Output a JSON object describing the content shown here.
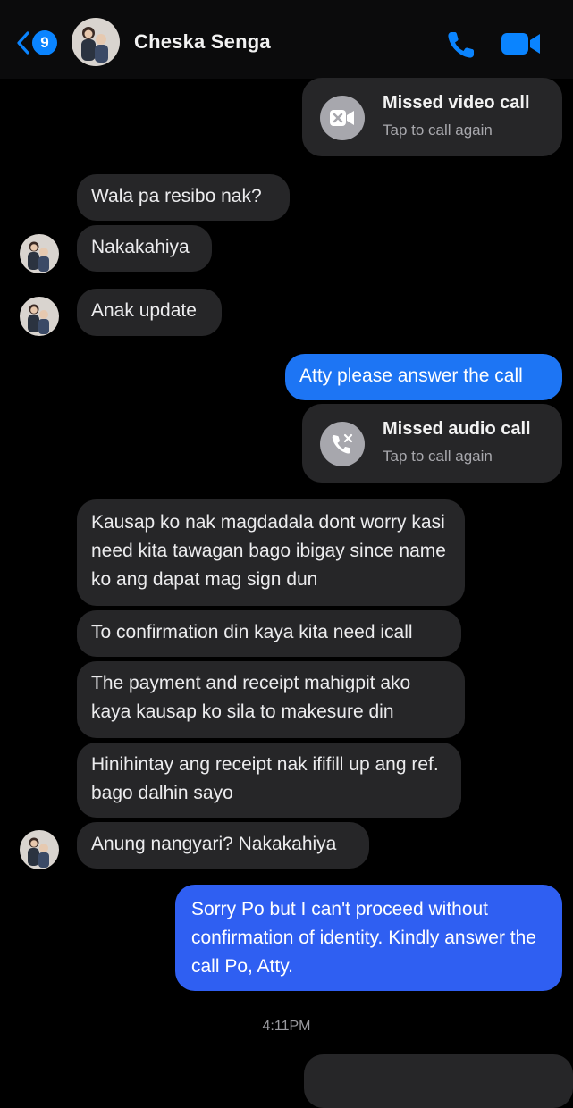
{
  "header": {
    "unread_count": "9",
    "contact_name": "Cheska Senga",
    "back_icon": "chevron-left-icon",
    "call_icon": "phone-icon",
    "video_icon": "video-camera-icon",
    "accent_color": "#0a84ff"
  },
  "messages": {
    "missed_video": {
      "title": "Missed video call",
      "subtitle": "Tap to call again",
      "icon": "video-missed-icon"
    },
    "m1": "Wala pa resibo nak?",
    "m2": "Nakakahiya",
    "m3": "Anak update",
    "m4": "Atty please answer the call",
    "missed_audio": {
      "title": "Missed audio call",
      "subtitle": "Tap to call again",
      "icon": "phone-missed-icon"
    },
    "m5": "Kausap ko nak magdadala dont worry kasi need kita tawagan bago ibigay since name ko ang dapat mag sign dun",
    "m6": "To confirmation din kaya kita need icall",
    "m7": "The payment and receipt mahigpit ako kaya kausap ko sila to makesure din",
    "m8": "Hinihintay ang receipt nak ififill up ang ref. bago dalhin sayo",
    "m9": "Anung nangyari? Nakakahiya",
    "m10": "Sorry Po but I can't proceed without confirmation of identity. Kindly answer the call Po, Atty."
  },
  "timestamp": "4:11PM",
  "colors": {
    "incoming_bubble": "#262628",
    "outgoing_bubble": "#2f5ff2",
    "background": "#000000"
  }
}
